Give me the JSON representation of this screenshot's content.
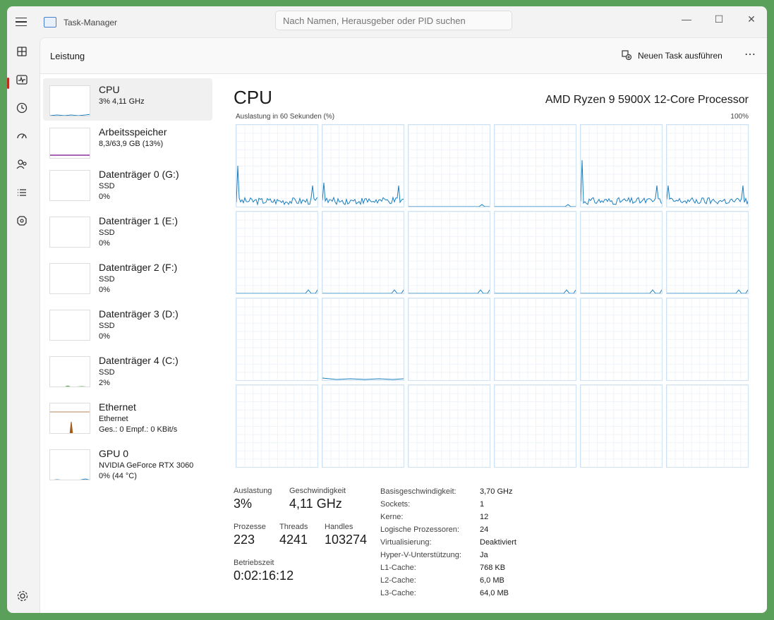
{
  "app": {
    "title": "Task-Manager"
  },
  "search": {
    "placeholder": "Nach Namen, Herausgeber oder PID suchen"
  },
  "window_controls": {
    "minimize": "—",
    "maximize": "☐",
    "close": "✕"
  },
  "navrail": {
    "items": [
      {
        "icon": "processes-icon"
      },
      {
        "icon": "performance-icon",
        "active": true
      },
      {
        "icon": "app-history-icon"
      },
      {
        "icon": "startup-apps-icon"
      },
      {
        "icon": "users-icon"
      },
      {
        "icon": "details-icon"
      },
      {
        "icon": "services-icon"
      }
    ],
    "settings_icon": "gear-icon"
  },
  "page": {
    "title": "Leistung",
    "new_task_label": "Neuen Task ausführen",
    "more_label": "⋯"
  },
  "devices": [
    {
      "name": "CPU",
      "line2": "3%  4,11 GHz",
      "line3": "",
      "selected": true,
      "color": "#1a7fbf"
    },
    {
      "name": "Arbeitsspeicher",
      "line2": "8,3/63,9 GB (13%)",
      "line3": "",
      "color": "#8b2fa0"
    },
    {
      "name": "Datenträger 0 (G:)",
      "line2": "SSD",
      "line3": "0%",
      "color": "#4c9b2f"
    },
    {
      "name": "Datenträger 1 (E:)",
      "line2": "SSD",
      "line3": "0%",
      "color": "#4c9b2f"
    },
    {
      "name": "Datenträger 2 (F:)",
      "line2": "SSD",
      "line3": "0%",
      "color": "#4c9b2f"
    },
    {
      "name": "Datenträger 3 (D:)",
      "line2": "SSD",
      "line3": "0%",
      "color": "#4c9b2f"
    },
    {
      "name": "Datenträger 4 (C:)",
      "line2": "SSD",
      "line3": "2%",
      "color": "#4c9b2f"
    },
    {
      "name": "Ethernet",
      "line2": "Ethernet",
      "line3": "Ges.: 0 Empf.: 0 KBit/s",
      "color": "#a75a1a"
    },
    {
      "name": "GPU 0",
      "line2": "NVIDIA GeForce RTX 3060",
      "line3": "0%  (44 °C)",
      "color": "#1a7fbf"
    }
  ],
  "cpu": {
    "title": "CPU",
    "model": "AMD Ryzen 9 5900X 12-Core Processor",
    "graph_label": "Auslastung in 60 Sekunden (%)",
    "graph_max": "100%",
    "line_color": "#1a7fbf",
    "logical_graphs": 24,
    "stats": {
      "util_label": "Auslastung",
      "util": "3%",
      "speed_label": "Geschwindigkeit",
      "speed": "4,11 GHz",
      "proc_label": "Prozesse",
      "proc": "223",
      "threads_label": "Threads",
      "threads": "4241",
      "handles_label": "Handles",
      "handles": "103274",
      "uptime_label": "Betriebszeit",
      "uptime": "0:02:16:12"
    },
    "info": [
      {
        "k": "Basisgeschwindigkeit:",
        "v": "3,70 GHz"
      },
      {
        "k": "Sockets:",
        "v": "1"
      },
      {
        "k": "Kerne:",
        "v": "12"
      },
      {
        "k": "Logische Prozessoren:",
        "v": "24"
      },
      {
        "k": "Virtualisierung:",
        "v": "Deaktiviert"
      },
      {
        "k": "Hyper-V-Unterstützung:",
        "v": "Ja"
      },
      {
        "k": "L1-Cache:",
        "v": "768 KB"
      },
      {
        "k": "L2-Cache:",
        "v": "6,0 MB"
      },
      {
        "k": "L3-Cache:",
        "v": "64,0 MB"
      }
    ]
  }
}
